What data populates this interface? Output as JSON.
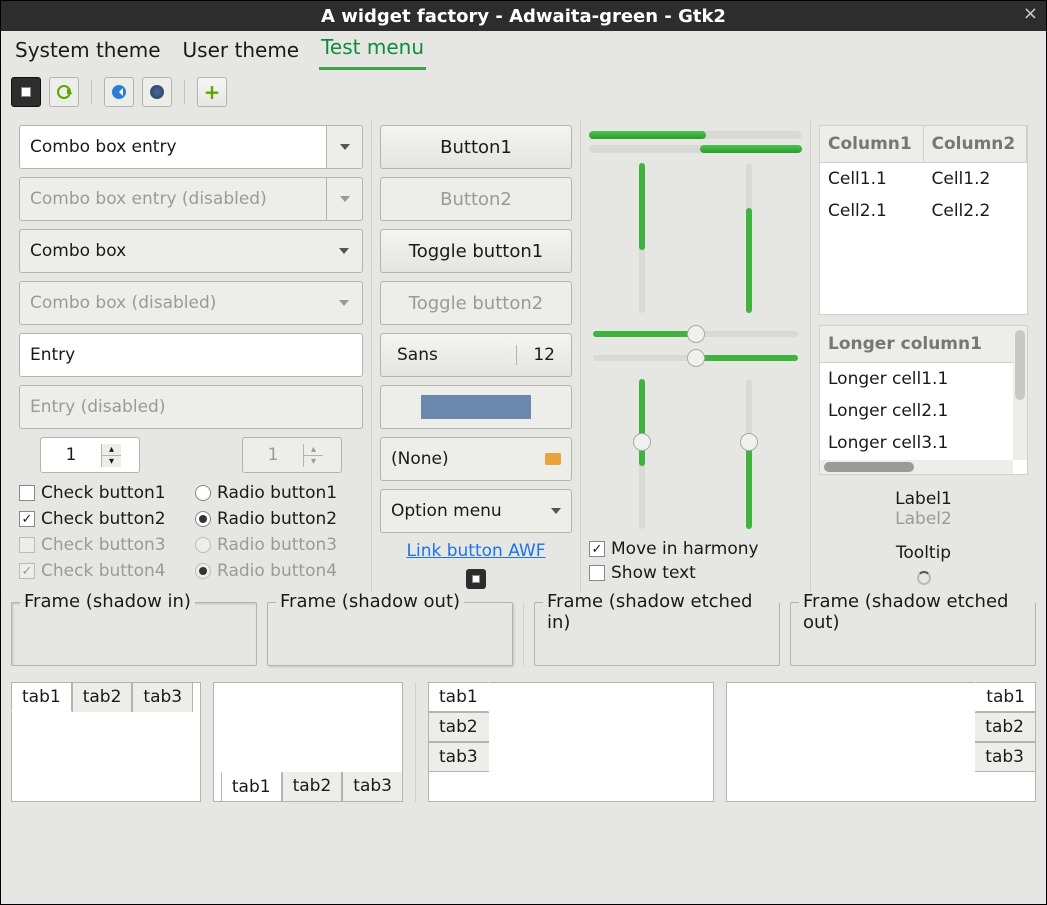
{
  "titlebar": {
    "title": "A widget factory - Adwaita-green - Gtk2"
  },
  "menubar": {
    "items": [
      {
        "label": "System theme",
        "active": false
      },
      {
        "label": "User theme",
        "active": false
      },
      {
        "label": "Test menu",
        "active": true
      }
    ]
  },
  "toolbar": {
    "icons": [
      "panel-icon",
      "refresh-icon",
      "back-icon",
      "globe-icon",
      "add-icon"
    ]
  },
  "col1": {
    "combo_entry": "Combo box entry",
    "combo_entry_disabled": "Combo box entry (disabled)",
    "combo": "Combo box",
    "combo_disabled": "Combo box (disabled)",
    "entry": "Entry",
    "entry_disabled": "Entry (disabled)",
    "spin_value": "1",
    "spin_disabled_value": "1",
    "checks": [
      {
        "label": "Check button1",
        "checked": false,
        "disabled": false
      },
      {
        "label": "Check button2",
        "checked": true,
        "disabled": false
      },
      {
        "label": "Check button3",
        "checked": false,
        "disabled": true
      },
      {
        "label": "Check button4",
        "checked": true,
        "disabled": true
      }
    ],
    "radios": [
      {
        "label": "Radio button1",
        "checked": false,
        "disabled": false
      },
      {
        "label": "Radio button2",
        "checked": true,
        "disabled": false
      },
      {
        "label": "Radio button3",
        "checked": false,
        "disabled": true
      },
      {
        "label": "Radio button4",
        "checked": true,
        "disabled": true
      }
    ]
  },
  "col2": {
    "button1": "Button1",
    "button2": "Button2",
    "toggle1": "Toggle button1",
    "toggle2": "Toggle button2",
    "font_name": "Sans",
    "font_size": "12",
    "color": "#6b87ac",
    "file": "(None)",
    "option": "Option menu",
    "link": "Link button AWF"
  },
  "col3": {
    "progress1_pct": 55,
    "progress2_pct": 45,
    "vscale1_pct": 60,
    "vscale2_pct": 70,
    "hscale1_pct": 50,
    "hscale2_pct": 50,
    "vslider1_pct": 40,
    "vslider2_pct": 45,
    "move_harmony": {
      "label": "Move in harmony",
      "checked": true
    },
    "show_text": {
      "label": "Show text",
      "checked": false
    }
  },
  "col4": {
    "tree1": {
      "columns": [
        "Column1",
        "Column2"
      ],
      "rows": [
        [
          "Cell1.1",
          "Cell1.2"
        ],
        [
          "Cell2.1",
          "Cell2.2"
        ]
      ]
    },
    "tree2": {
      "column": "Longer column1",
      "rows": [
        "Longer cell1.1",
        "Longer cell2.1",
        "Longer cell3.1"
      ]
    },
    "label1": "Label1",
    "label2": "Label2",
    "tooltip": "Tooltip"
  },
  "frames": [
    "Frame (shadow in)",
    "Frame (shadow out)",
    "Frame (shadow etched in)",
    "Frame (shadow etched out)"
  ],
  "notebook_tabs": [
    "tab1",
    "tab2",
    "tab3"
  ]
}
